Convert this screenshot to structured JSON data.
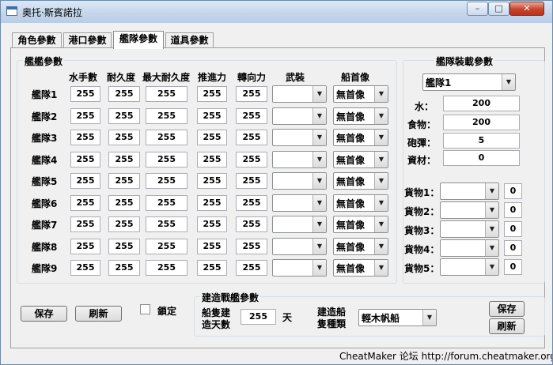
{
  "window": {
    "title": "奧托·斯賓諾拉",
    "minimize_glyph": "–",
    "maximize_glyph": "□",
    "close_glyph": "✕"
  },
  "tabs": [
    {
      "label": "角色參數"
    },
    {
      "label": "港口參數"
    },
    {
      "label": "艦隊參數"
    },
    {
      "label": "道具參數"
    }
  ],
  "fleet_params": {
    "group_label": "艦艦參數",
    "headers": {
      "sailors": "水手數",
      "durability": "耐久度",
      "max_durability": "最大耐久度",
      "propulsion": "推進力",
      "turning": "轉向力",
      "weapons": "武裝",
      "figurehead": "船首像"
    },
    "rows": [
      {
        "label": "艦隊1",
        "sailors": "255",
        "durability": "255",
        "max_durability": "255",
        "propulsion": "255",
        "turning": "255",
        "weapons": "",
        "figurehead": "無首像"
      },
      {
        "label": "艦隊2",
        "sailors": "255",
        "durability": "255",
        "max_durability": "255",
        "propulsion": "255",
        "turning": "255",
        "weapons": "",
        "figurehead": "無首像"
      },
      {
        "label": "艦隊3",
        "sailors": "255",
        "durability": "255",
        "max_durability": "255",
        "propulsion": "255",
        "turning": "255",
        "weapons": "",
        "figurehead": "無首像"
      },
      {
        "label": "艦隊4",
        "sailors": "255",
        "durability": "255",
        "max_durability": "255",
        "propulsion": "255",
        "turning": "255",
        "weapons": "",
        "figurehead": "無首像"
      },
      {
        "label": "艦隊5",
        "sailors": "255",
        "durability": "255",
        "max_durability": "255",
        "propulsion": "255",
        "turning": "255",
        "weapons": "",
        "figurehead": "無首像"
      },
      {
        "label": "艦隊6",
        "sailors": "255",
        "durability": "255",
        "max_durability": "255",
        "propulsion": "255",
        "turning": "255",
        "weapons": "",
        "figurehead": "無首像"
      },
      {
        "label": "艦隊7",
        "sailors": "255",
        "durability": "255",
        "max_durability": "255",
        "propulsion": "255",
        "turning": "255",
        "weapons": "",
        "figurehead": "無首像"
      },
      {
        "label": "艦隊8",
        "sailors": "255",
        "durability": "255",
        "max_durability": "255",
        "propulsion": "255",
        "turning": "255",
        "weapons": "",
        "figurehead": "無首像"
      },
      {
        "label": "艦隊9",
        "sailors": "255",
        "durability": "255",
        "max_durability": "255",
        "propulsion": "255",
        "turning": "255",
        "weapons": "",
        "figurehead": "無首像"
      }
    ]
  },
  "cargo": {
    "group_label": "艦隊裝載參數",
    "fleet_select": "艦隊1",
    "water_label": "水：",
    "water": "200",
    "food_label": "食物：",
    "food": "200",
    "ammo_label": "砲彈：",
    "ammo": "5",
    "material_label": "資材：",
    "material": "0",
    "goods": [
      {
        "label": "貨物1：",
        "type": "",
        "qty": "0"
      },
      {
        "label": "貨物2：",
        "type": "",
        "qty": "0"
      },
      {
        "label": "貨物3：",
        "type": "",
        "qty": "0"
      },
      {
        "label": "貨物4：",
        "type": "",
        "qty": "0"
      },
      {
        "label": "貨物5：",
        "type": "",
        "qty": "0"
      }
    ]
  },
  "bottom": {
    "save_label": "保存",
    "refresh_label": "刷新",
    "lock_label": "鎖定",
    "lock_checked": false
  },
  "build": {
    "group_label": "建造戰艦參數",
    "days_label_line1": "船隻建",
    "days_label_line2": "造天數",
    "days": "255",
    "days_unit": "天",
    "type_label_line1": "建造船",
    "type_label_line2": "隻種類",
    "ship_type": "輕木帆船",
    "save_label": "保存",
    "refresh_label": "刷新"
  },
  "footer": {
    "text": "CheatMaker 论坛 http://forum.cheatmaker.org/"
  },
  "colors": {
    "accent": "#3b6db0",
    "close": "#c7432a"
  }
}
